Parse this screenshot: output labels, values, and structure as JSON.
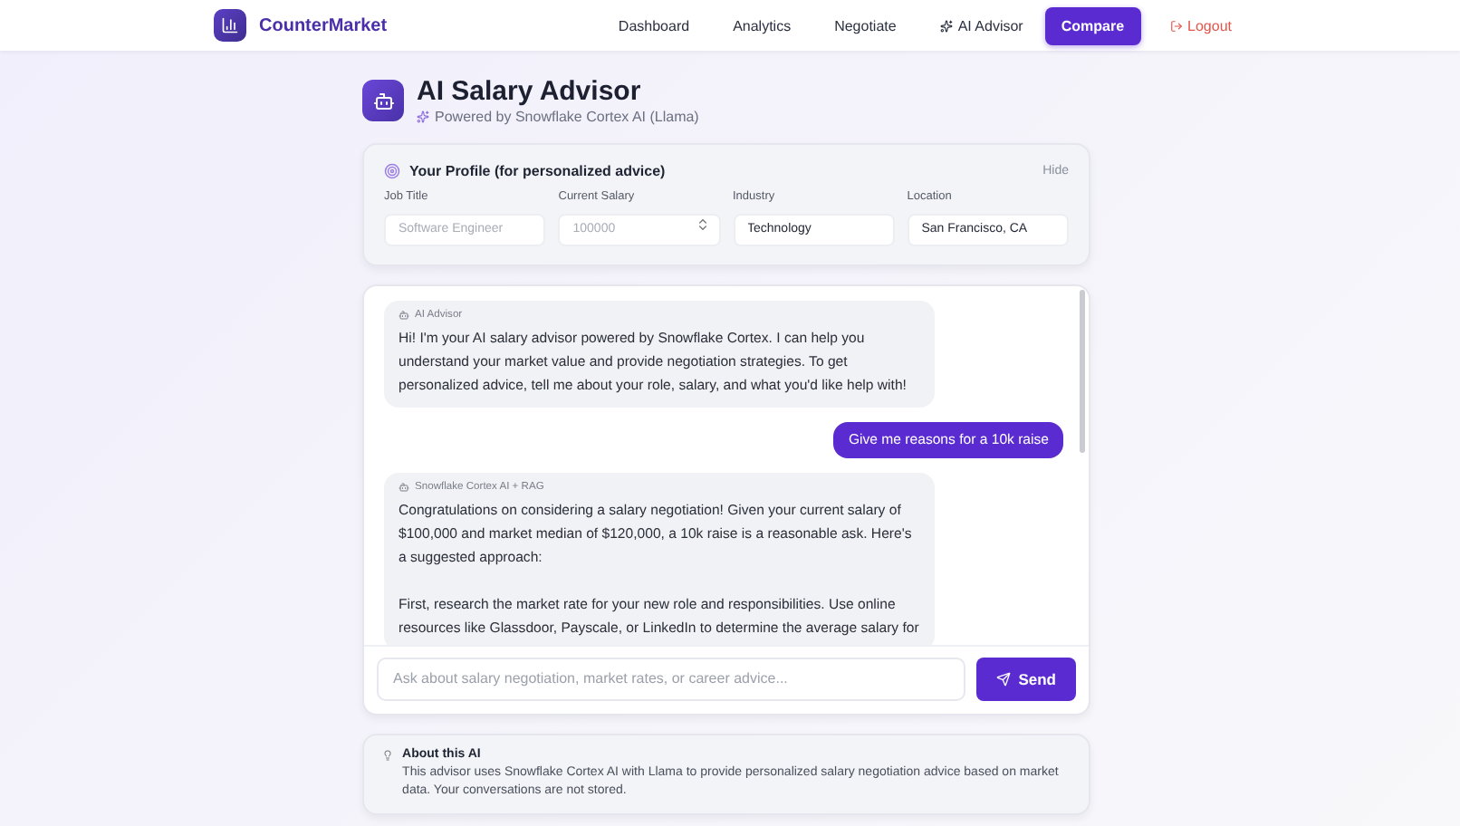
{
  "brand": {
    "name": "CounterMarket"
  },
  "nav": [
    {
      "label": "Dashboard",
      "kind": "link",
      "selected": false
    },
    {
      "label": "Analytics",
      "kind": "link",
      "selected": false
    },
    {
      "label": "Negotiate",
      "kind": "link",
      "selected": false
    },
    {
      "label": "AI Advisor",
      "kind": "ai",
      "selected": false
    },
    {
      "label": "Compare",
      "kind": "link",
      "selected": true
    },
    {
      "label": "Logout",
      "kind": "logout",
      "selected": false
    }
  ],
  "header": {
    "title": "AI Salary Advisor",
    "subtitle": "Powered by Snowflake Cortex AI (Llama)"
  },
  "profile": {
    "title": "Your Profile (for personalized advice)",
    "toggle": "Hide",
    "fields": [
      {
        "label": "Job Title",
        "placeholder": "Software Engineer",
        "kind": "text"
      },
      {
        "label": "Current Salary",
        "placeholder": "100000",
        "kind": "number"
      },
      {
        "label": "Industry",
        "value": "Technology",
        "kind": "text"
      },
      {
        "label": "Location",
        "value": "San Francisco, CA",
        "kind": "text"
      }
    ]
  },
  "messages": [
    {
      "kind": "assistant",
      "sender": "AI Advisor",
      "paragraphs": [
        "Hi! I'm your AI salary advisor powered by Snowflake Cortex. I can help you understand your market value and provide negotiation strategies. To get personalized advice, tell me about your role, salary, and what you'd like help with!"
      ]
    },
    {
      "kind": "user",
      "paragraphs": [
        "Give me reasons for a 10k raise"
      ]
    },
    {
      "kind": "assistant",
      "sender": "Snowflake Cortex AI + RAG",
      "paragraphs": [
        "Congratulations on considering a salary negotiation! Given your current salary of $100,000 and market median of $120,000, a 10k raise is a reasonable ask. Here's a suggested approach:",
        "First, research the market rate for your new role and responsibilities. Use online resources like Glassdoor, Payscale, or LinkedIn to determine the average salary for"
      ]
    }
  ],
  "composer": {
    "placeholder": "Ask about salary negotiation, market rates, or career advice...",
    "button": "Send"
  },
  "about": {
    "title": "About this AI",
    "text": "This advisor uses Snowflake Cortex AI with Llama to provide personalized salary negotiation advice based on market data. Your conversations are not stored."
  }
}
